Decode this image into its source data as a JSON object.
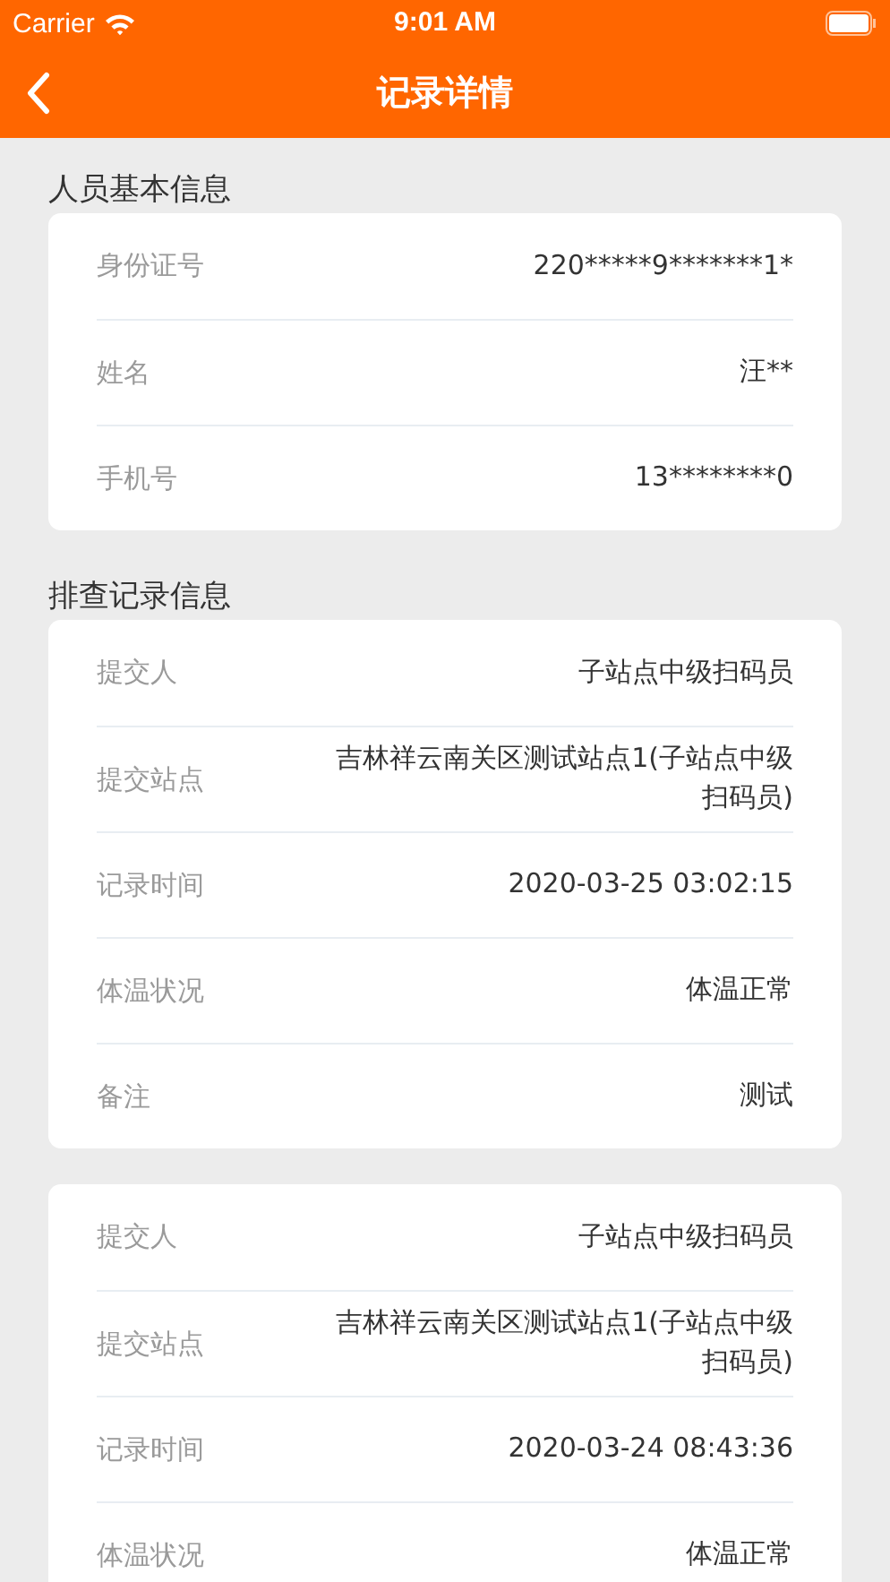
{
  "status_bar": {
    "carrier": "Carrier",
    "time": "9:01 AM"
  },
  "nav_bar": {
    "title": "记录详情"
  },
  "sections": [
    {
      "title": "人员基本信息",
      "cards": [
        {
          "rows": [
            {
              "label": "身份证号",
              "value": "220*****9*******1*"
            },
            {
              "label": "姓名",
              "value": "汪**"
            },
            {
              "label": "手机号",
              "value": "13********0"
            }
          ]
        }
      ]
    },
    {
      "title": "排查记录信息",
      "cards": [
        {
          "rows": [
            {
              "label": "提交人",
              "value": "子站点中级扫码员"
            },
            {
              "label": "提交站点",
              "value": "吉林祥云南关区测试站点1(子站点中级扫码员)"
            },
            {
              "label": "记录时间",
              "value": "2020-03-25 03:02:15"
            },
            {
              "label": "体温状况",
              "value": "体温正常"
            },
            {
              "label": "备注",
              "value": "测试"
            }
          ]
        },
        {
          "rows": [
            {
              "label": "提交人",
              "value": "子站点中级扫码员"
            },
            {
              "label": "提交站点",
              "value": "吉林祥云南关区测试站点1(子站点中级扫码员)"
            },
            {
              "label": "记录时间",
              "value": "2020-03-24 08:43:36"
            },
            {
              "label": "体温状况",
              "value": "体温正常"
            }
          ]
        }
      ]
    }
  ]
}
